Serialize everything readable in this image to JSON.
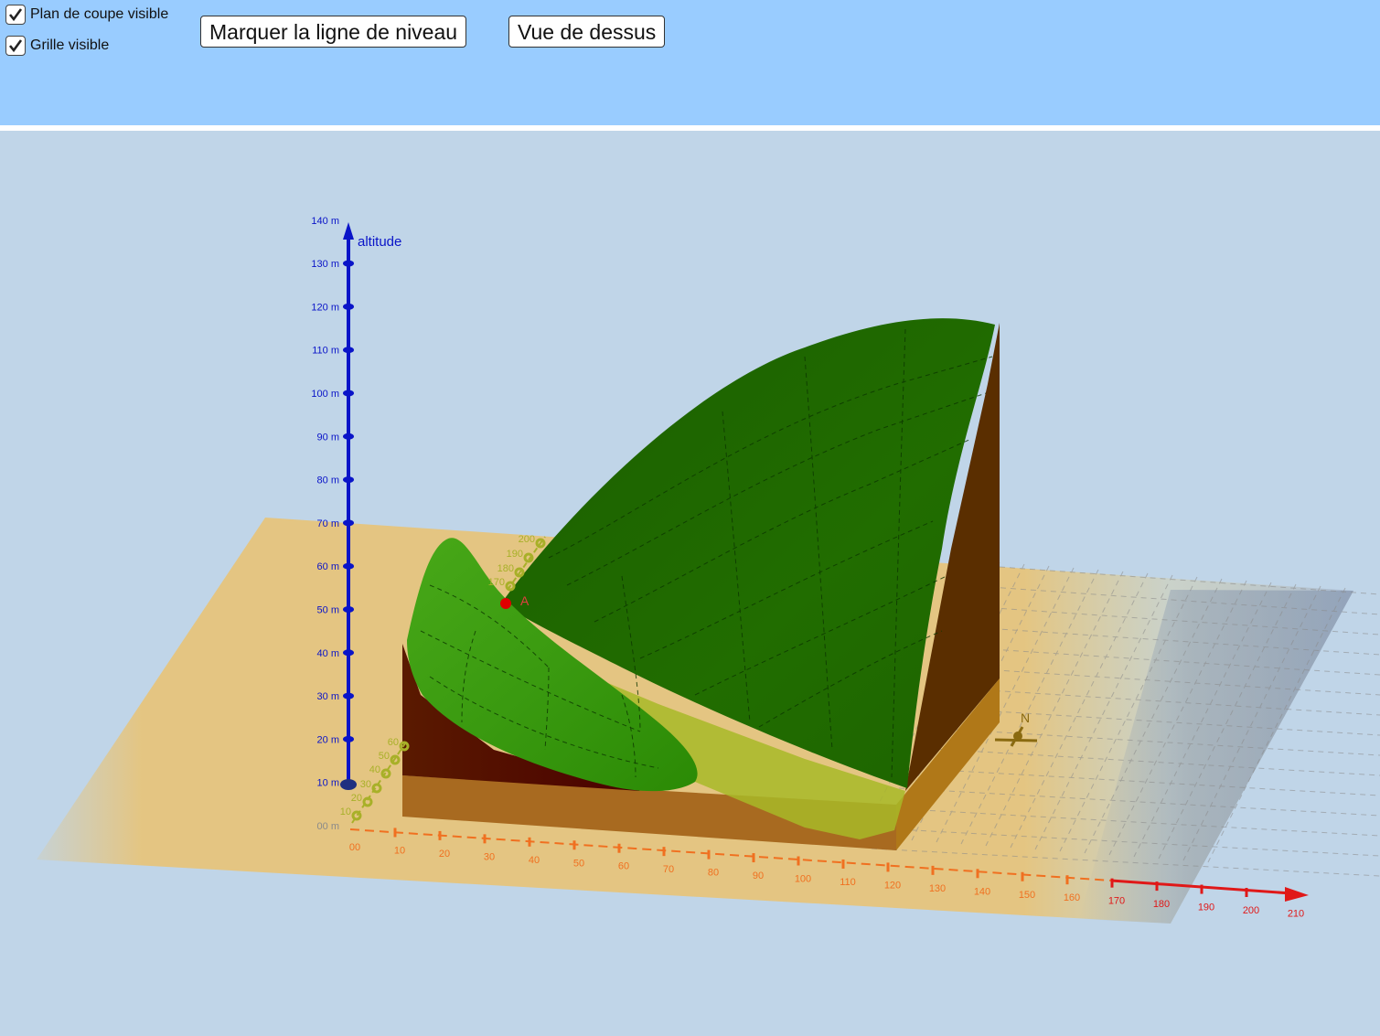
{
  "toolbar": {
    "checkbox_cut_plane": {
      "label": "Plan de coupe visible",
      "checked": true
    },
    "checkbox_grid": {
      "label": "Grille visible",
      "checked": true
    },
    "button_level_line": "Marquer la ligne de niveau",
    "button_top_view": "Vue de dessus"
  },
  "view3d": {
    "z_axis": {
      "label": "altitude",
      "ticks": [
        "00 m",
        "10 m",
        "20 m",
        "30 m",
        "40 m",
        "50 m",
        "60 m",
        "70 m",
        "80 m",
        "90 m",
        "100 m",
        "110 m",
        "120 m",
        "130 m",
        "140 m"
      ]
    },
    "x_axis": {
      "ticks": [
        "00",
        "10",
        "20",
        "30",
        "40",
        "50",
        "60",
        "70",
        "80",
        "90",
        "100",
        "110",
        "120",
        "130",
        "140",
        "150",
        "160",
        "170",
        "180",
        "190",
        "200",
        "210"
      ]
    },
    "y_axis": {
      "ticks": [
        "10",
        "20",
        "30",
        "40",
        "50",
        "60",
        "170",
        "180",
        "190",
        "200"
      ]
    },
    "point_label": "A",
    "north_label": "N",
    "colors": {
      "z_axis": "#0a14c8",
      "x_axis_near": "#f07020",
      "x_axis_far": "#e01818",
      "y_axis": "#a8b028",
      "surface_dark": "#1f6a00",
      "surface_light": "#3fa010",
      "soil_side": "#5a2e00",
      "soil_front": "#a86a20"
    }
  }
}
